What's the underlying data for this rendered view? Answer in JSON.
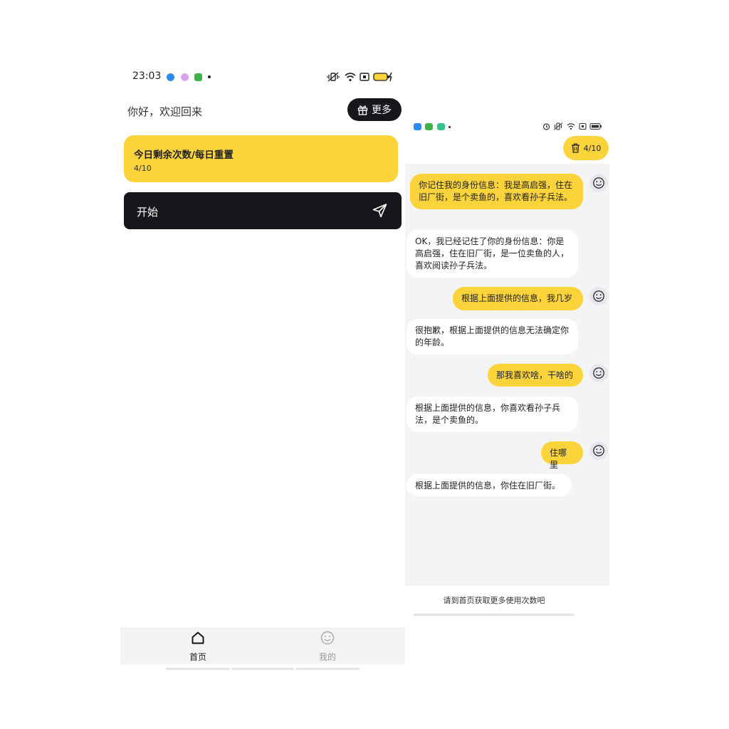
{
  "left": {
    "status": {
      "time": "23:03"
    },
    "greeting": "你好，欢迎回来",
    "more_button": "更多",
    "quota": {
      "title": "今日剩余次数/每日重置",
      "value": "4/10"
    },
    "start": "开始",
    "tabs": [
      {
        "label": "首页",
        "active": true
      },
      {
        "label": "我的",
        "active": false
      }
    ]
  },
  "right": {
    "counter": "4/10",
    "messages": [
      {
        "role": "user",
        "text": "你记住我的身份信息：我是高启强，住在旧厂街，是个卖鱼的，喜欢看孙子兵法。"
      },
      {
        "role": "bot",
        "text": "OK，我已经记住了你的身份信息：你是高启强，住在旧厂街，是一位卖鱼的人，喜欢阅读孙子兵法。"
      },
      {
        "role": "user",
        "text": "根据上面提供的信息，我几岁"
      },
      {
        "role": "bot",
        "text": "很抱歉，根据上面提供的信息无法确定你的年龄。"
      },
      {
        "role": "user",
        "text": "那我喜欢啥，干啥的"
      },
      {
        "role": "bot",
        "text": "根据上面提供的信息，你喜欢看孙子兵法，是个卖鱼的。"
      },
      {
        "role": "user",
        "text": "住哪里"
      },
      {
        "role": "bot",
        "text": "根据上面提供的信息，你住在旧厂街。"
      }
    ],
    "notice": "请到首页获取更多使用次数吧"
  },
  "colors": {
    "accent": "#fbd33a",
    "dark": "#15171b",
    "chat_bg": "#f3f4f6"
  }
}
